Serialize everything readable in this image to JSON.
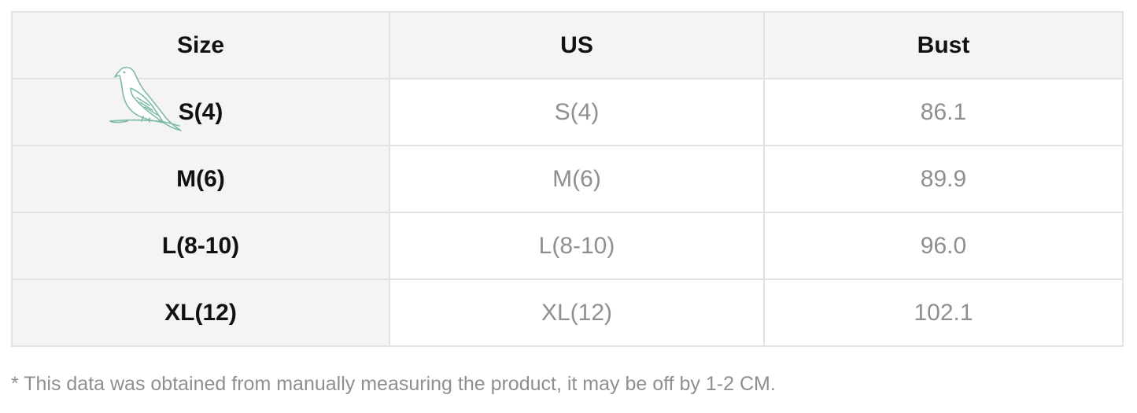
{
  "table": {
    "headers": [
      "Size",
      "US",
      "Bust"
    ],
    "rows": [
      {
        "size": "S(4)",
        "us": "S(4)",
        "bust": "86.1"
      },
      {
        "size": "M(6)",
        "us": "M(6)",
        "bust": "89.9"
      },
      {
        "size": "L(8-10)",
        "us": "L(8-10)",
        "bust": "96.0"
      },
      {
        "size": "XL(12)",
        "us": "XL(12)",
        "bust": "102.1"
      }
    ]
  },
  "note": "* This data was obtained from manually measuring the product, it may be off by 1-2 CM.",
  "watermark": {
    "icon": "bird-icon"
  },
  "colors": {
    "header_bg": "#f4f4f4",
    "border": "#e2e2e2",
    "muted_text": "#8f8f8f",
    "dark_text": "#111111",
    "bird_stroke": "#7fb9a7"
  }
}
